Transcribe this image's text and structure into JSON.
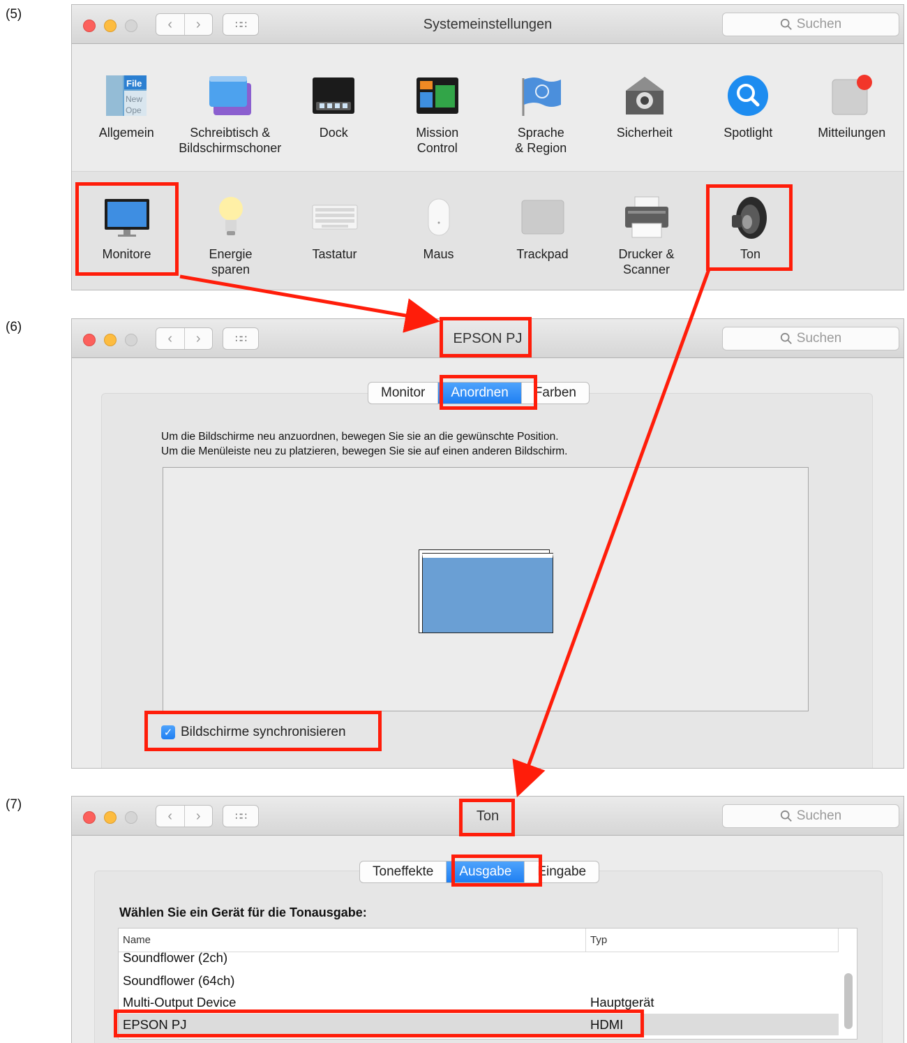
{
  "steps": {
    "five": "(5)",
    "six": "(6)",
    "seven": "(7)"
  },
  "common": {
    "search_placeholder": "Suchen",
    "grid_glyph": "∷∷"
  },
  "win1": {
    "title": "Systemeinstellungen",
    "row1": [
      {
        "label": "Allgemein",
        "icon": "general-icon"
      },
      {
        "label": "Schreibtisch &\nBildschirmschoner",
        "icon": "desktop-screensaver-icon"
      },
      {
        "label": "Dock",
        "icon": "dock-icon"
      },
      {
        "label": "Mission\nControl",
        "icon": "mission-control-icon"
      },
      {
        "label": "Sprache\n& Region",
        "icon": "language-region-icon"
      },
      {
        "label": "Sicherheit",
        "icon": "security-icon"
      },
      {
        "label": "Spotlight",
        "icon": "spotlight-icon"
      },
      {
        "label": "Mitteilungen",
        "icon": "notifications-icon"
      }
    ],
    "row2": [
      {
        "label": "Monitore",
        "icon": "displays-icon"
      },
      {
        "label": "Energie\nsparen",
        "icon": "energy-saver-icon"
      },
      {
        "label": "Tastatur",
        "icon": "keyboard-icon"
      },
      {
        "label": "Maus",
        "icon": "mouse-icon"
      },
      {
        "label": "Trackpad",
        "icon": "trackpad-icon"
      },
      {
        "label": "Drucker &\nScanner",
        "icon": "printer-scanner-icon"
      },
      {
        "label": "Ton",
        "icon": "sound-icon"
      }
    ]
  },
  "win2": {
    "title": "EPSON PJ",
    "tabs": [
      "Monitor",
      "Anordnen",
      "Farben"
    ],
    "active_tab": "Anordnen",
    "instructions": "Um die Bildschirme neu anzuordnen, bewegen Sie sie an die gewünschte Position.\nUm die Menüleiste neu zu platzieren, bewegen Sie sie auf einen anderen Bildschirm.",
    "mirror_label": "Bildschirme synchronisieren",
    "mirror_checked": true
  },
  "win3": {
    "title": "Ton",
    "tabs": [
      "Toneffekte",
      "Ausgabe",
      "Eingabe"
    ],
    "active_tab": "Ausgabe",
    "heading": "Wählen Sie ein Gerät für die Tonausgabe:",
    "columns": [
      "Name",
      "Typ"
    ],
    "rows": [
      {
        "name": "Soundflower (2ch)",
        "type": ""
      },
      {
        "name": "Soundflower (64ch)",
        "type": ""
      },
      {
        "name": "Multi-Output Device",
        "type": "Hauptgerät"
      },
      {
        "name": "EPSON PJ",
        "type": "HDMI"
      }
    ],
    "selected_row": "EPSON PJ"
  },
  "colors": {
    "highlight": "#ff1d0a",
    "accent": "#1f7ff2"
  }
}
